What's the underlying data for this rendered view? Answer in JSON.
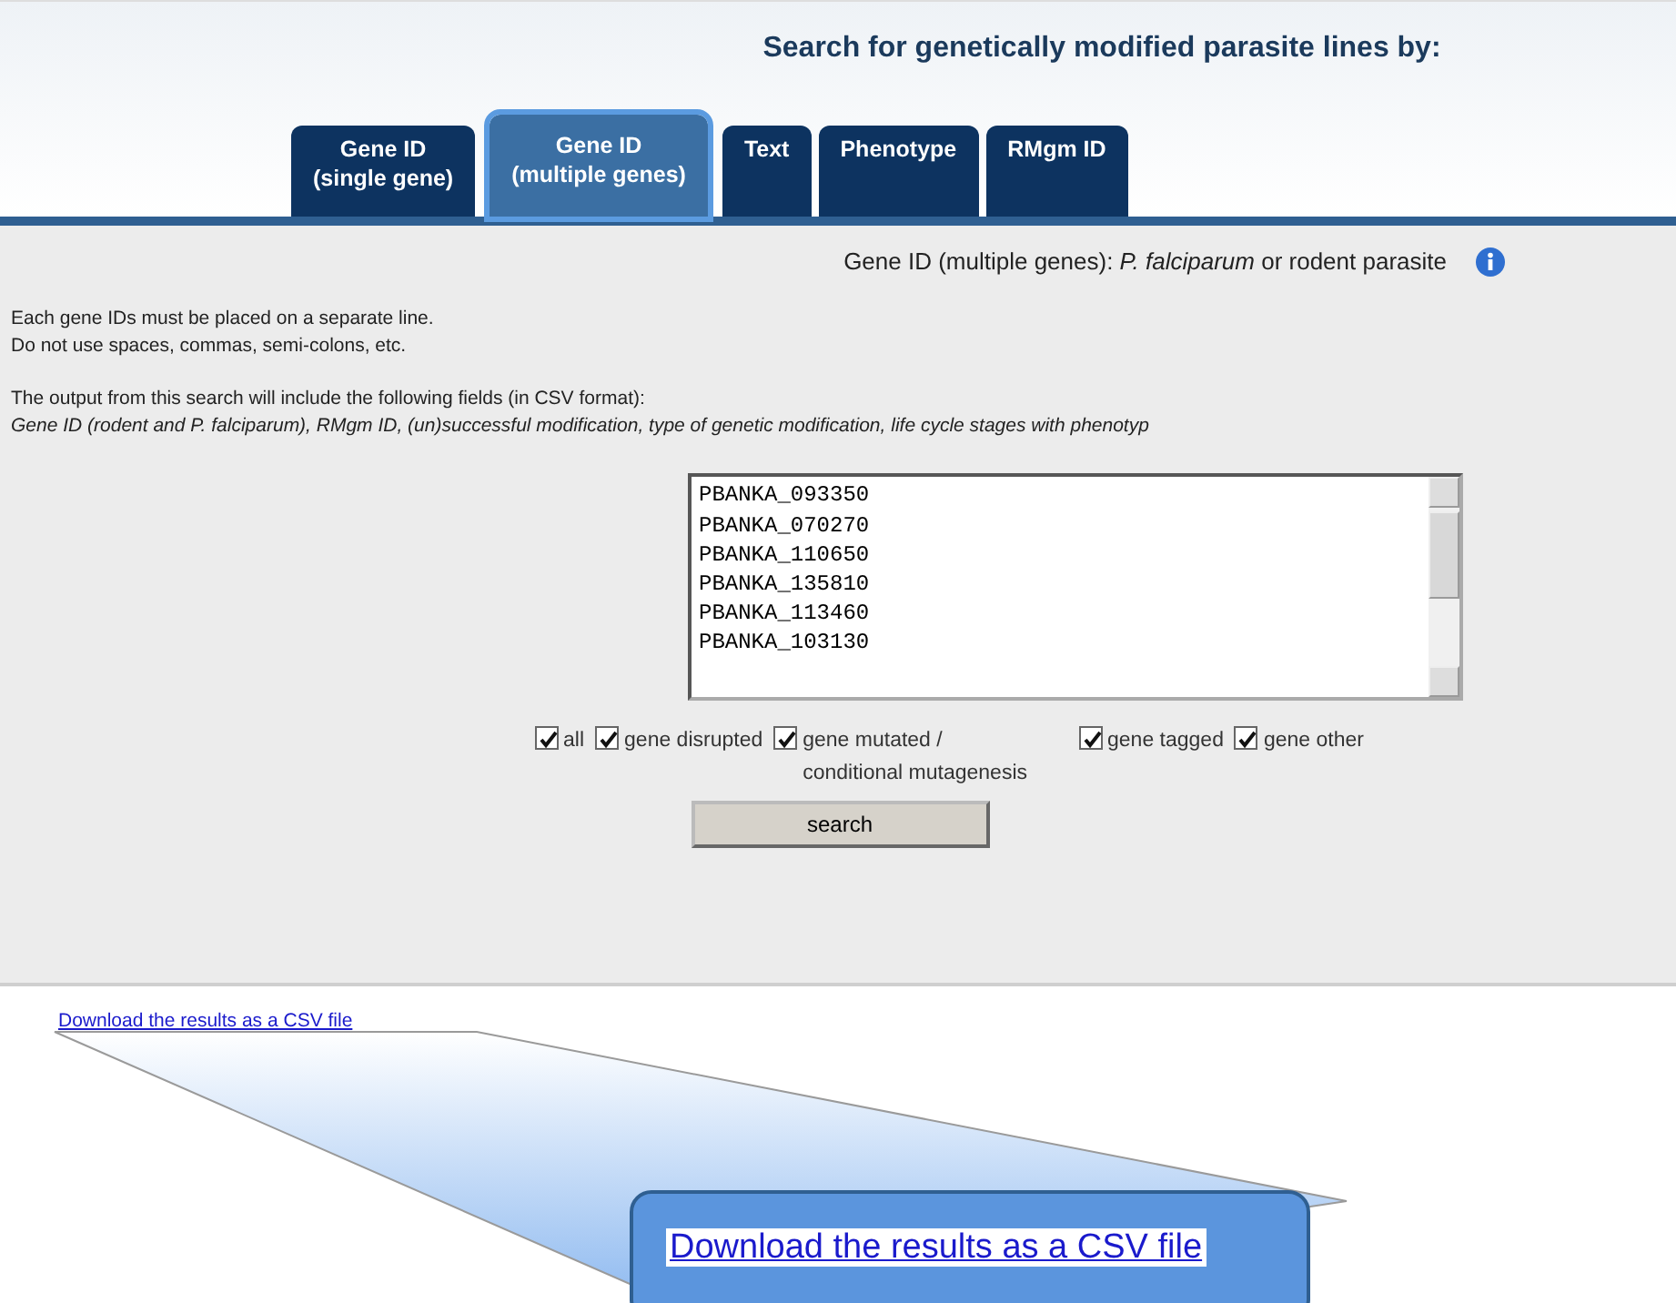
{
  "heading": "Search for genetically modified parasite lines by:",
  "tabs": [
    {
      "label": [
        "Gene ID",
        "(single gene)"
      ],
      "selected": false
    },
    {
      "label": [
        "Gene ID",
        "(multiple genes)"
      ],
      "selected": true
    },
    {
      "label": [
        "Text"
      ],
      "selected": false
    },
    {
      "label": [
        "Phenotype"
      ],
      "selected": false
    },
    {
      "label": [
        "RMgm ID"
      ],
      "selected": false
    }
  ],
  "panel": {
    "subtitle": "Gene ID (multiple genes): *P. falciparum* or rodent parasite",
    "instructions": [
      "Each gene IDs must be placed on a separate line.",
      "Do not use spaces, commas, semi-colons, etc."
    ],
    "output_intro": "The output from this search will include the following fields (in CSV format):",
    "output_fields": "Gene ID (rodent and P. falciparum), RMgm ID, (un)successful modification, type of genetic modification, life cycle stages with phenotyp",
    "gene_ids": [
      "PBANKA_093350",
      "PBANKA_070270",
      "PBANKA_110650",
      "PBANKA_135810",
      "PBANKA_113460",
      "PBANKA_103130"
    ],
    "filters": [
      {
        "label": [
          "all"
        ],
        "checked": true
      },
      {
        "label": [
          "gene disrupted"
        ],
        "checked": true
      },
      {
        "label": [
          "gene mutated /",
          "conditional mutagenesis"
        ],
        "checked": true
      },
      {
        "label": [
          "gene tagged"
        ],
        "checked": true
      },
      {
        "label": [
          "gene other"
        ],
        "checked": true
      }
    ],
    "search_button": "search"
  },
  "download_link": "Download the results as a CSV file",
  "callout": {
    "link": "Download the results as a CSV file"
  }
}
